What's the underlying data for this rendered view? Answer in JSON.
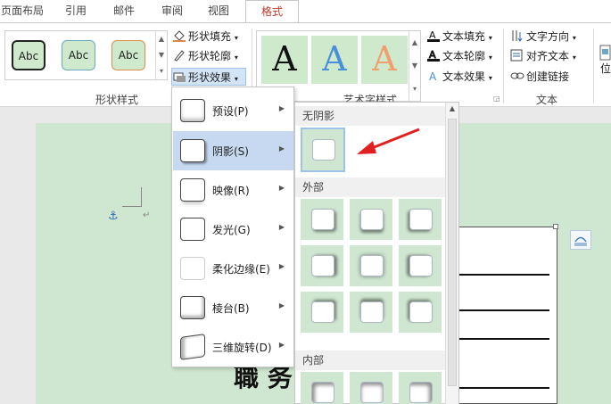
{
  "tabs": [
    {
      "label": "页面布局"
    },
    {
      "label": "引用"
    },
    {
      "label": "邮件"
    },
    {
      "label": "审阅"
    },
    {
      "label": "视图"
    },
    {
      "label": "格式"
    }
  ],
  "ribbon": {
    "shape_styles": {
      "label": "形状样式",
      "gallery": [
        "Abc",
        "Abc",
        "Abc"
      ],
      "fill": "形状填充",
      "outline": "形状轮廓",
      "effects": "形状效果"
    },
    "art_styles": {
      "label": "艺术字样式",
      "letters": [
        "A",
        "A",
        "A"
      ],
      "text_fill": "文本填充",
      "text_outline": "文本轮廓",
      "text_effects": "文本效果"
    },
    "text_group": {
      "label": "文本",
      "direction": "文字方向",
      "align": "对齐文本",
      "link": "创建链接"
    },
    "position_partial": "位"
  },
  "effects_menu": [
    {
      "label": "预设(P)"
    },
    {
      "label": "阴影(S)"
    },
    {
      "label": "映像(R)"
    },
    {
      "label": "发光(G)"
    },
    {
      "label": "柔化边缘(E)"
    },
    {
      "label": "棱台(B)"
    },
    {
      "label": "三维旋转(D)"
    }
  ],
  "shadow_submenu": {
    "no_shadow": "无阴影",
    "outer": "外部",
    "inner": "内部"
  },
  "document": {
    "big_text": "職 务"
  },
  "colors": {
    "accent": "#c0392b",
    "page_green": "#cfe6d0",
    "highlight": "#c7d9f1"
  }
}
